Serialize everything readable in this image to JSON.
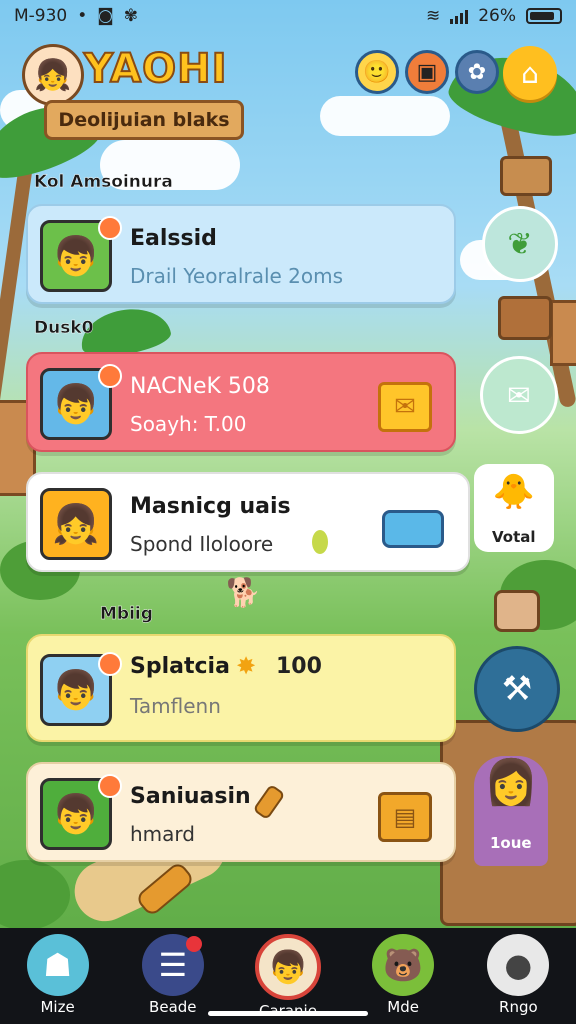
{
  "status_bar": {
    "time": "M-930",
    "battery": "26%"
  },
  "header": {
    "logo": "YAOHI",
    "banner": "Deolijuian blaks",
    "buttons": [
      {
        "icon": "smiley-icon"
      },
      {
        "icon": "crate-icon"
      },
      {
        "icon": "flower-icon"
      }
    ],
    "home_icon": "house-icon"
  },
  "sections": {
    "top": "Kol Amsoinura",
    "middle": "Dusk0",
    "lower": "Mbiig"
  },
  "cards": [
    {
      "title": "Ealssid",
      "subtitle": "Drail Yeoralrale 2oms",
      "color": "#cbe9fb"
    },
    {
      "title": "NACNeK 508",
      "subtitle": "Soayh: T.00",
      "color": "#f4767f"
    },
    {
      "title": "Masnicg uais",
      "subtitle": "Spond Iloloore",
      "color": "#ffffff"
    },
    {
      "title": "Splatcia",
      "value": "100",
      "subtitle": "Tamflenn",
      "color": "#fbf3a6"
    },
    {
      "title": "Saniuasin",
      "subtitle": "hmard",
      "color": "#fdf0d8"
    }
  ],
  "side": {
    "character_label": "Votal",
    "npc_label": "1oue"
  },
  "nav": [
    {
      "label": "Mize",
      "icon": "ghost-icon"
    },
    {
      "label": "Beade",
      "icon": "notes-icon"
    },
    {
      "label": "Caranie",
      "icon": "character-icon"
    },
    {
      "label": "Mde",
      "icon": "bear-icon"
    },
    {
      "label": "Rngo",
      "icon": "profile-icon"
    }
  ]
}
